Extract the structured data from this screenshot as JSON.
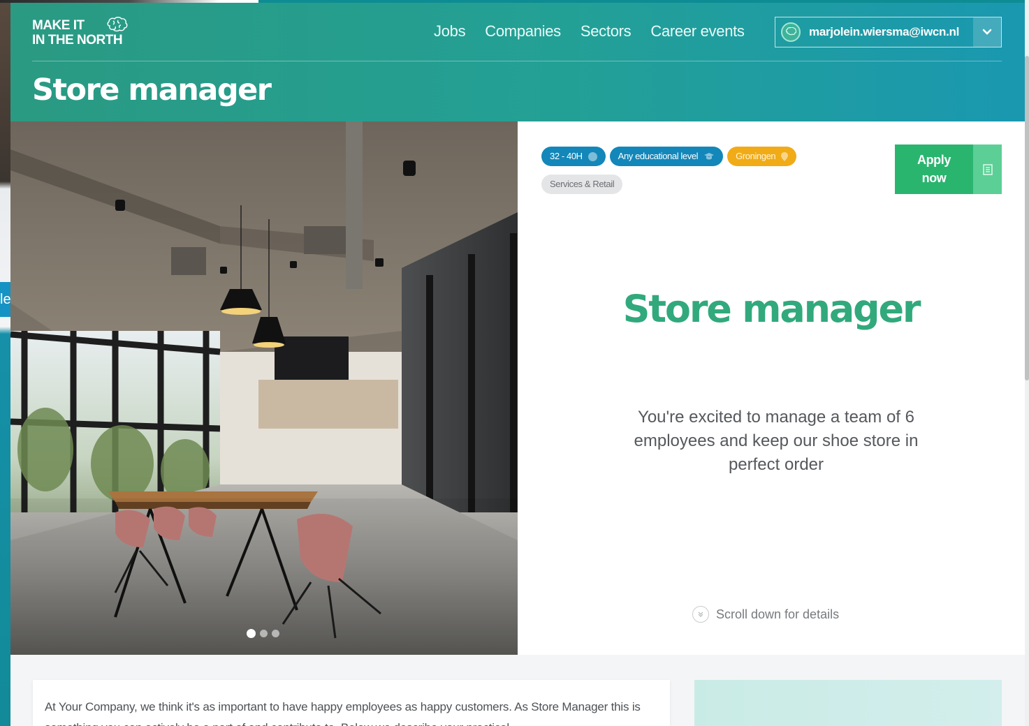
{
  "site": {
    "logo_line1": "MAKE IT",
    "logo_line2": "IN THE NORTH",
    "brand_green": "#2a9a82",
    "brand_teal": "#1a98b0"
  },
  "nav": {
    "items": [
      {
        "label": "Jobs"
      },
      {
        "label": "Companies"
      },
      {
        "label": "Sectors"
      },
      {
        "label": "Career events"
      }
    ]
  },
  "user": {
    "email": "marjolein.wiersma@iwcn.nl",
    "avatar_icon": "brain-icon",
    "dropdown_icon": "chevron-down-icon"
  },
  "page": {
    "title": "Store manager"
  },
  "hero": {
    "slides_total": 3,
    "active_slide": 1
  },
  "job": {
    "tags": [
      {
        "label": "32 - 40H",
        "style": "blue",
        "icon": "info-icon"
      },
      {
        "label": "Any educational level",
        "style": "blue",
        "icon": "graduation-cap-icon"
      },
      {
        "label": "Groningen",
        "style": "orange",
        "icon": "map-pin-icon"
      },
      {
        "label": "Services & Retail",
        "style": "grey"
      }
    ],
    "apply_line1": "Apply",
    "apply_line2": "now",
    "apply_color": "#2ab56f",
    "title": "Store manager",
    "description": "You're excited to manage a team of 6 employees and keep our shoe store in perfect order",
    "scroll_hint": "Scroll down for details"
  },
  "intro": {
    "text": "At Your Company, we think it's as important to have happy employees as happy customers. As Store Manager this is something you can actively be a part of and contribute to. Below we describe your practical"
  }
}
